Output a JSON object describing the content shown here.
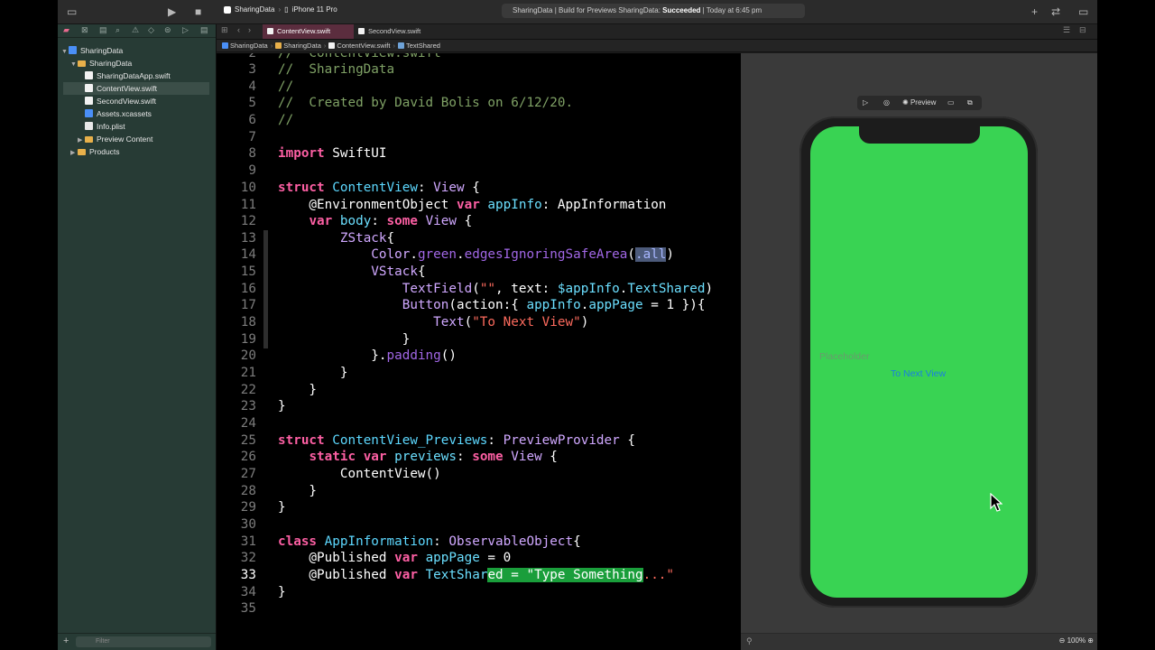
{
  "toolbar": {
    "scheme_app": "SharingData",
    "scheme_device": "iPhone 11 Pro",
    "activity_prefix": "SharingData | Build for Previews SharingData: ",
    "activity_status": "Succeeded",
    "activity_suffix": " | Today at 6:45 pm"
  },
  "navigator": {
    "items": [
      {
        "label": "SharingData",
        "kind": "project"
      },
      {
        "label": "SharingData",
        "kind": "folder"
      },
      {
        "label": "SharingDataApp.swift",
        "kind": "swift"
      },
      {
        "label": "ContentView.swift",
        "kind": "swift",
        "selected": true
      },
      {
        "label": "SecondView.swift",
        "kind": "swift"
      },
      {
        "label": "Assets.xcassets",
        "kind": "assets"
      },
      {
        "label": "Info.plist",
        "kind": "plist"
      },
      {
        "label": "Preview Content",
        "kind": "folder"
      },
      {
        "label": "Products",
        "kind": "folder"
      }
    ],
    "filter_placeholder": "Filter"
  },
  "tabs": [
    {
      "label": "ContentView.swift",
      "active": true
    },
    {
      "label": "SecondView.swift",
      "active": false
    }
  ],
  "jumpbar": [
    "SharingData",
    "SharingData",
    "ContentView.swift",
    "TextShared"
  ],
  "editor": {
    "current_line": 33
  },
  "preview": {
    "toolbar_label": "Preview",
    "textfield_placeholder": "Placeholder",
    "button_label": "To Next View",
    "zoom": "100%",
    "screen_color": "#39d353"
  },
  "colors": {
    "accent_tab": "#5b2d3e",
    "navigator_bg": "#273b35",
    "keyword": "#fc5fa3",
    "string": "#fc6a5d"
  }
}
